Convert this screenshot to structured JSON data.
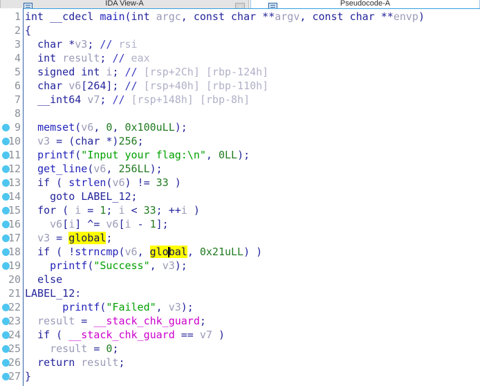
{
  "window": {
    "tabs": [
      {
        "label": "IDA View-A",
        "icon": "document-icon",
        "active": false,
        "has_close": true,
        "close_label": "▫"
      },
      {
        "label": "Pseudocode-A",
        "icon": "document-icon",
        "active": true,
        "has_close": false
      }
    ]
  },
  "editor": {
    "highlighted_word": "global",
    "caret_line": 18,
    "breakpoint_lines": [
      9,
      10,
      11,
      12,
      13,
      14,
      15,
      16,
      17,
      18,
      19,
      22,
      23,
      24,
      25,
      26,
      27
    ],
    "colors": {
      "keyword": "#23239c",
      "function": "#2222bb",
      "variable": "#9a9ab8",
      "number": "#1f7a1f",
      "string": "#00a000",
      "comment": "#b0b0c8",
      "global_symbol": "#cc00cc",
      "highlight_background": "#ffff00",
      "breakpoint_dot": "#4ec6f0",
      "line_number": "#8a9099",
      "background": "#ffffff"
    },
    "lines": [
      {
        "n": 1,
        "text": "int __cdecl main(int argc, const char **argv, const char **envp)"
      },
      {
        "n": 2,
        "text": "{"
      },
      {
        "n": 3,
        "text": "  char *v3; // rsi"
      },
      {
        "n": 4,
        "text": "  int result; // eax"
      },
      {
        "n": 5,
        "text": "  signed int i; // [rsp+2Ch] [rbp-124h]"
      },
      {
        "n": 6,
        "text": "  char v6[264]; // [rsp+40h] [rbp-110h]"
      },
      {
        "n": 7,
        "text": "  __int64 v7; // [rsp+148h] [rbp-8h]"
      },
      {
        "n": 8,
        "text": ""
      },
      {
        "n": 9,
        "text": "  memset(v6, 0, 0x100uLL);"
      },
      {
        "n": 10,
        "text": "  v3 = (char *)256;"
      },
      {
        "n": 11,
        "text": "  printf(\"Input your flag:\\n\", 0LL);"
      },
      {
        "n": 12,
        "text": "  get_line(v6, 256LL);"
      },
      {
        "n": 13,
        "text": "  if ( strlen(v6) != 33 )"
      },
      {
        "n": 14,
        "text": "    goto LABEL_12;"
      },
      {
        "n": 15,
        "text": "  for ( i = 1; i < 33; ++i )"
      },
      {
        "n": 16,
        "text": "    v6[i] ^= v6[i - 1];"
      },
      {
        "n": 17,
        "text": "  v3 = global;"
      },
      {
        "n": 18,
        "text": "  if ( !strncmp(v6, global, 0x21uLL) )"
      },
      {
        "n": 19,
        "text": "    printf(\"Success\", v3);"
      },
      {
        "n": 20,
        "text": "  else"
      },
      {
        "n": 21,
        "text": "LABEL_12:"
      },
      {
        "n": 22,
        "text": "    printf(\"Failed\", v3);"
      },
      {
        "n": 23,
        "text": "  result = __stack_chk_guard;"
      },
      {
        "n": 24,
        "text": "  if ( __stack_chk_guard == v7 )"
      },
      {
        "n": 25,
        "text": "    result = 0;"
      },
      {
        "n": 26,
        "text": "  return result;"
      },
      {
        "n": 27,
        "text": "}"
      }
    ],
    "tokens": {
      "1": [
        [
          "kw",
          "int "
        ],
        [
          "kw",
          "__cdecl "
        ],
        [
          "fn",
          "main"
        ],
        [
          "punc",
          "("
        ],
        [
          "kw",
          "int "
        ],
        [
          "var",
          "argc"
        ],
        [
          "punc",
          ", "
        ],
        [
          "kw",
          "const char "
        ],
        [
          "punc",
          "**"
        ],
        [
          "var",
          "argv"
        ],
        [
          "punc",
          ", "
        ],
        [
          "kw",
          "const char "
        ],
        [
          "punc",
          "**"
        ],
        [
          "var",
          "envp"
        ],
        [
          "punc",
          ")"
        ]
      ],
      "2": [
        [
          "punc",
          "{"
        ]
      ],
      "3": [
        [
          "punc",
          "  "
        ],
        [
          "kw",
          "char "
        ],
        [
          "punc",
          "*"
        ],
        [
          "var",
          "v3"
        ],
        [
          "punc",
          "; "
        ],
        [
          "cmtm",
          "// "
        ],
        [
          "cmt",
          "rsi"
        ]
      ],
      "4": [
        [
          "punc",
          "  "
        ],
        [
          "kw",
          "int "
        ],
        [
          "var",
          "result"
        ],
        [
          "punc",
          "; "
        ],
        [
          "cmtm",
          "// "
        ],
        [
          "cmt",
          "eax"
        ]
      ],
      "5": [
        [
          "punc",
          "  "
        ],
        [
          "kw",
          "signed int "
        ],
        [
          "var",
          "i"
        ],
        [
          "punc",
          "; "
        ],
        [
          "cmtm",
          "// "
        ],
        [
          "cmt",
          "[rsp+2Ch] [rbp-124h]"
        ]
      ],
      "6": [
        [
          "punc",
          "  "
        ],
        [
          "kw",
          "char "
        ],
        [
          "var",
          "v6"
        ],
        [
          "punc",
          "[264]; "
        ],
        [
          "cmtm",
          "// "
        ],
        [
          "cmt",
          "[rsp+40h] [rbp-110h]"
        ]
      ],
      "7": [
        [
          "punc",
          "  "
        ],
        [
          "kw",
          "__int64 "
        ],
        [
          "var",
          "v7"
        ],
        [
          "punc",
          "; "
        ],
        [
          "cmtm",
          "// "
        ],
        [
          "cmt",
          "[rsp+148h] [rbp-8h]"
        ]
      ],
      "8": [],
      "9": [
        [
          "punc",
          "  "
        ],
        [
          "fn",
          "memset"
        ],
        [
          "punc",
          "("
        ],
        [
          "var",
          "v6"
        ],
        [
          "punc",
          ", "
        ],
        [
          "num",
          "0"
        ],
        [
          "punc",
          ", "
        ],
        [
          "num",
          "0x100uLL"
        ],
        [
          "punc",
          ");"
        ]
      ],
      "10": [
        [
          "punc",
          "  "
        ],
        [
          "var",
          "v3"
        ],
        [
          "punc",
          " = ("
        ],
        [
          "kw",
          "char "
        ],
        [
          "punc",
          "*)"
        ],
        [
          "num",
          "256"
        ],
        [
          "punc",
          ";"
        ]
      ],
      "11": [
        [
          "punc",
          "  "
        ],
        [
          "fn",
          "printf"
        ],
        [
          "punc",
          "("
        ],
        [
          "str",
          "\"Input your flag:\\n\""
        ],
        [
          "punc",
          ", "
        ],
        [
          "num",
          "0LL"
        ],
        [
          "punc",
          ");"
        ]
      ],
      "12": [
        [
          "punc",
          "  "
        ],
        [
          "fn",
          "get_line"
        ],
        [
          "punc",
          "("
        ],
        [
          "var",
          "v6"
        ],
        [
          "punc",
          ", "
        ],
        [
          "num",
          "256LL"
        ],
        [
          "punc",
          ");"
        ]
      ],
      "13": [
        [
          "punc",
          "  "
        ],
        [
          "kw",
          "if"
        ],
        [
          "punc",
          " ( "
        ],
        [
          "fn",
          "strlen"
        ],
        [
          "punc",
          "("
        ],
        [
          "var",
          "v6"
        ],
        [
          "punc",
          ") != "
        ],
        [
          "num",
          "33"
        ],
        [
          "punc",
          " )"
        ]
      ],
      "14": [
        [
          "punc",
          "    "
        ],
        [
          "kw",
          "goto "
        ],
        [
          "lbl",
          "LABEL_12"
        ],
        [
          "punc",
          ";"
        ]
      ],
      "15": [
        [
          "punc",
          "  "
        ],
        [
          "kw",
          "for"
        ],
        [
          "punc",
          " ( "
        ],
        [
          "var",
          "i"
        ],
        [
          "punc",
          " = "
        ],
        [
          "num",
          "1"
        ],
        [
          "punc",
          "; "
        ],
        [
          "var",
          "i"
        ],
        [
          "punc",
          " < "
        ],
        [
          "num",
          "33"
        ],
        [
          "punc",
          "; ++"
        ],
        [
          "var",
          "i"
        ],
        [
          "punc",
          " )"
        ]
      ],
      "16": [
        [
          "punc",
          "    "
        ],
        [
          "var",
          "v6"
        ],
        [
          "punc",
          "["
        ],
        [
          "var",
          "i"
        ],
        [
          "punc",
          "] ^= "
        ],
        [
          "var",
          "v6"
        ],
        [
          "punc",
          "["
        ],
        [
          "var",
          "i"
        ],
        [
          "punc",
          " - "
        ],
        [
          "num",
          "1"
        ],
        [
          "punc",
          "];"
        ]
      ],
      "17": [
        [
          "punc",
          "  "
        ],
        [
          "var",
          "v3"
        ],
        [
          "punc",
          " = "
        ],
        [
          "hl",
          "global"
        ],
        [
          "punc",
          ";"
        ]
      ],
      "18": [
        [
          "punc",
          "  "
        ],
        [
          "kw",
          "if"
        ],
        [
          "punc",
          " ( !"
        ],
        [
          "fn",
          "strncmp"
        ],
        [
          "punc",
          "("
        ],
        [
          "var",
          "v6"
        ],
        [
          "punc",
          ", "
        ],
        [
          "hlcaret",
          "global"
        ],
        [
          "punc",
          ", "
        ],
        [
          "num",
          "0x21uLL"
        ],
        [
          "punc",
          ") )"
        ]
      ],
      "19": [
        [
          "punc",
          "    "
        ],
        [
          "fn",
          "printf"
        ],
        [
          "punc",
          "("
        ],
        [
          "str",
          "\"Success\""
        ],
        [
          "punc",
          ", "
        ],
        [
          "var",
          "v3"
        ],
        [
          "punc",
          ");"
        ]
      ],
      "20": [
        [
          "punc",
          "  "
        ],
        [
          "kw",
          "else"
        ]
      ],
      "21": [
        [
          "lbl",
          "LABEL_12"
        ],
        [
          "punc",
          ":"
        ]
      ],
      "22": [
        [
          "punc",
          "      "
        ],
        [
          "fn",
          "printf"
        ],
        [
          "punc",
          "("
        ],
        [
          "str",
          "\"Failed\""
        ],
        [
          "punc",
          ", "
        ],
        [
          "var",
          "v3"
        ],
        [
          "punc",
          ");"
        ]
      ],
      "23": [
        [
          "punc",
          "  "
        ],
        [
          "var",
          "result"
        ],
        [
          "punc",
          " = "
        ],
        [
          "glob",
          "__stack_chk_guard"
        ],
        [
          "punc",
          ";"
        ]
      ],
      "24": [
        [
          "punc",
          "  "
        ],
        [
          "kw",
          "if"
        ],
        [
          "punc",
          " ( "
        ],
        [
          "glob",
          "__stack_chk_guard"
        ],
        [
          "punc",
          " == "
        ],
        [
          "var",
          "v7"
        ],
        [
          "punc",
          " )"
        ]
      ],
      "25": [
        [
          "punc",
          "    "
        ],
        [
          "var",
          "result"
        ],
        [
          "punc",
          " = "
        ],
        [
          "num",
          "0"
        ],
        [
          "punc",
          ";"
        ]
      ],
      "26": [
        [
          "punc",
          "  "
        ],
        [
          "kw",
          "return "
        ],
        [
          "var",
          "result"
        ],
        [
          "punc",
          ";"
        ]
      ],
      "27": [
        [
          "punc",
          "}"
        ]
      ]
    }
  }
}
